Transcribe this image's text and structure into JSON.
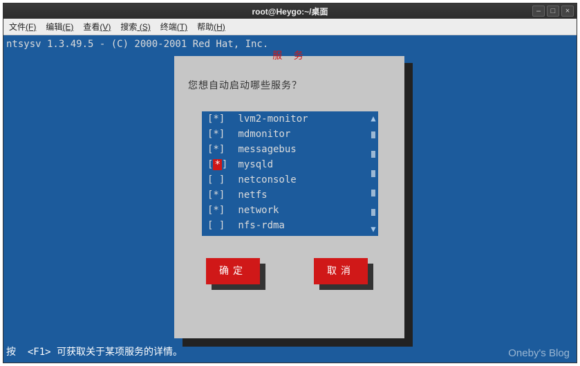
{
  "window": {
    "title": "root@Heygo:~/桌面",
    "controls": {
      "min": "–",
      "max": "□",
      "close": "×"
    }
  },
  "menubar": {
    "items": [
      {
        "label": "文件",
        "accel": "(F)"
      },
      {
        "label": "编辑",
        "accel": "(E)"
      },
      {
        "label": "查看",
        "accel": "(V)"
      },
      {
        "label": "搜索",
        "accel": " (S)"
      },
      {
        "label": "终端",
        "accel": "(T)"
      },
      {
        "label": "帮助",
        "accel": "(H)"
      }
    ]
  },
  "terminal": {
    "header": "ntsysv 1.3.49.5 - (C) 2000-2001 Red Hat, Inc.",
    "footer": "按  <F1> 可获取关于某项服务的详情。"
  },
  "dialog": {
    "title": "服 务",
    "question": "您想自动启动哪些服务？",
    "services": [
      {
        "checked": true,
        "selected": false,
        "name": "lvm2-monitor"
      },
      {
        "checked": true,
        "selected": false,
        "name": "mdmonitor"
      },
      {
        "checked": true,
        "selected": false,
        "name": "messagebus"
      },
      {
        "checked": true,
        "selected": true,
        "name": "mysqld"
      },
      {
        "checked": false,
        "selected": false,
        "name": "netconsole"
      },
      {
        "checked": true,
        "selected": false,
        "name": "netfs"
      },
      {
        "checked": true,
        "selected": false,
        "name": "network"
      },
      {
        "checked": false,
        "selected": false,
        "name": "nfs-rdma"
      }
    ],
    "buttons": {
      "ok": "确定",
      "cancel": "取消"
    }
  },
  "watermark": "Oneby's Blog"
}
